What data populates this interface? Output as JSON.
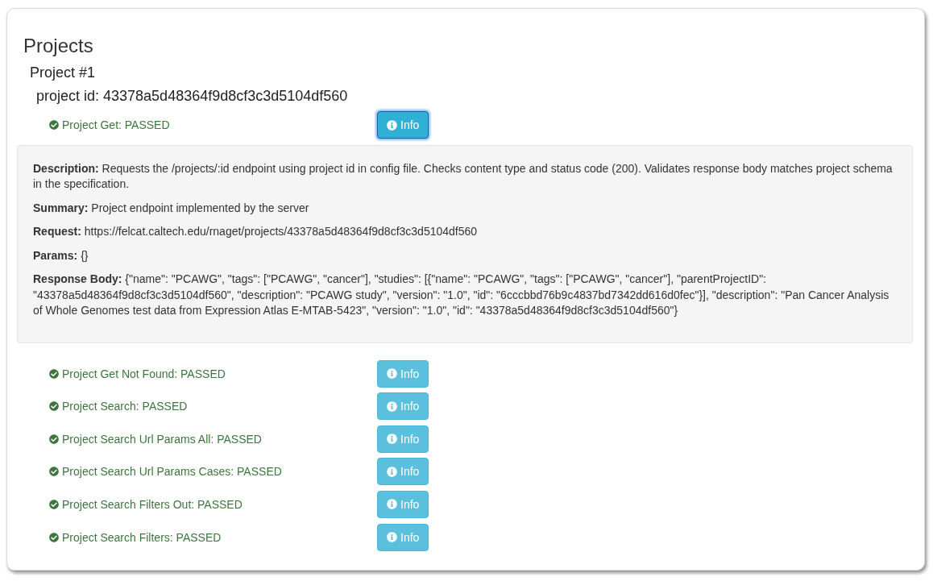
{
  "title": "Projects",
  "projects": [
    {
      "heading": "Project #1",
      "project_id": "project id: 43378a5d48364f9d8cf3c3d5104df560",
      "tests": [
        {
          "label": "Project Get: PASSED",
          "kind": "passed",
          "button": "Info",
          "expanded": true,
          "details": [
            {
              "label": "Description:",
              "text": "Requests the /projects/:id endpoint using project id in config file. Checks content type and status code (200). Validates response body matches project schema in the specification."
            },
            {
              "label": "Summary:",
              "text": "Project endpoint implemented by the server"
            },
            {
              "label": "Request:",
              "text": "https://felcat.caltech.edu/rnaget/projects/43378a5d48364f9d8cf3c3d5104df560"
            },
            {
              "label": "Params:",
              "text": "{}"
            },
            {
              "label": "Response Body:",
              "text": "{\"name\": \"PCAWG\", \"tags\": [\"PCAWG\", \"cancer\"], \"studies\": [{\"name\": \"PCAWG\", \"tags\": [\"PCAWG\", \"cancer\"], \"parentProjectID\": \"43378a5d48364f9d8cf3c3d5104df560\", \"description\": \"PCAWG study\", \"version\": \"1.0\", \"id\": \"6cccbbd76b9c4837bd7342dd616d0fec\"}], \"description\": \"Pan Cancer Analysis of Whole Genomes test data from Expression Atlas E-MTAB-5423\", \"version\": \"1.0\", \"id\": \"43378a5d48364f9d8cf3c3d5104df560\"}"
            }
          ]
        },
        {
          "label": "Project Get Not Found: PASSED",
          "kind": "passed",
          "button": "Info",
          "expanded": false
        },
        {
          "label": "Project Search: PASSED",
          "kind": "passed",
          "button": "Info",
          "expanded": false
        },
        {
          "label": "Project Search Url Params All: PASSED",
          "kind": "passed",
          "button": "Info",
          "expanded": false
        },
        {
          "label": "Project Search Url Params Cases: PASSED",
          "kind": "passed",
          "button": "Info",
          "expanded": false
        },
        {
          "label": "Project Search Filters Out: PASSED",
          "kind": "passed",
          "button": "Info",
          "expanded": false
        },
        {
          "label": "Project Search Filters: PASSED",
          "kind": "passed",
          "button": "Info",
          "expanded": false
        }
      ]
    }
  ]
}
